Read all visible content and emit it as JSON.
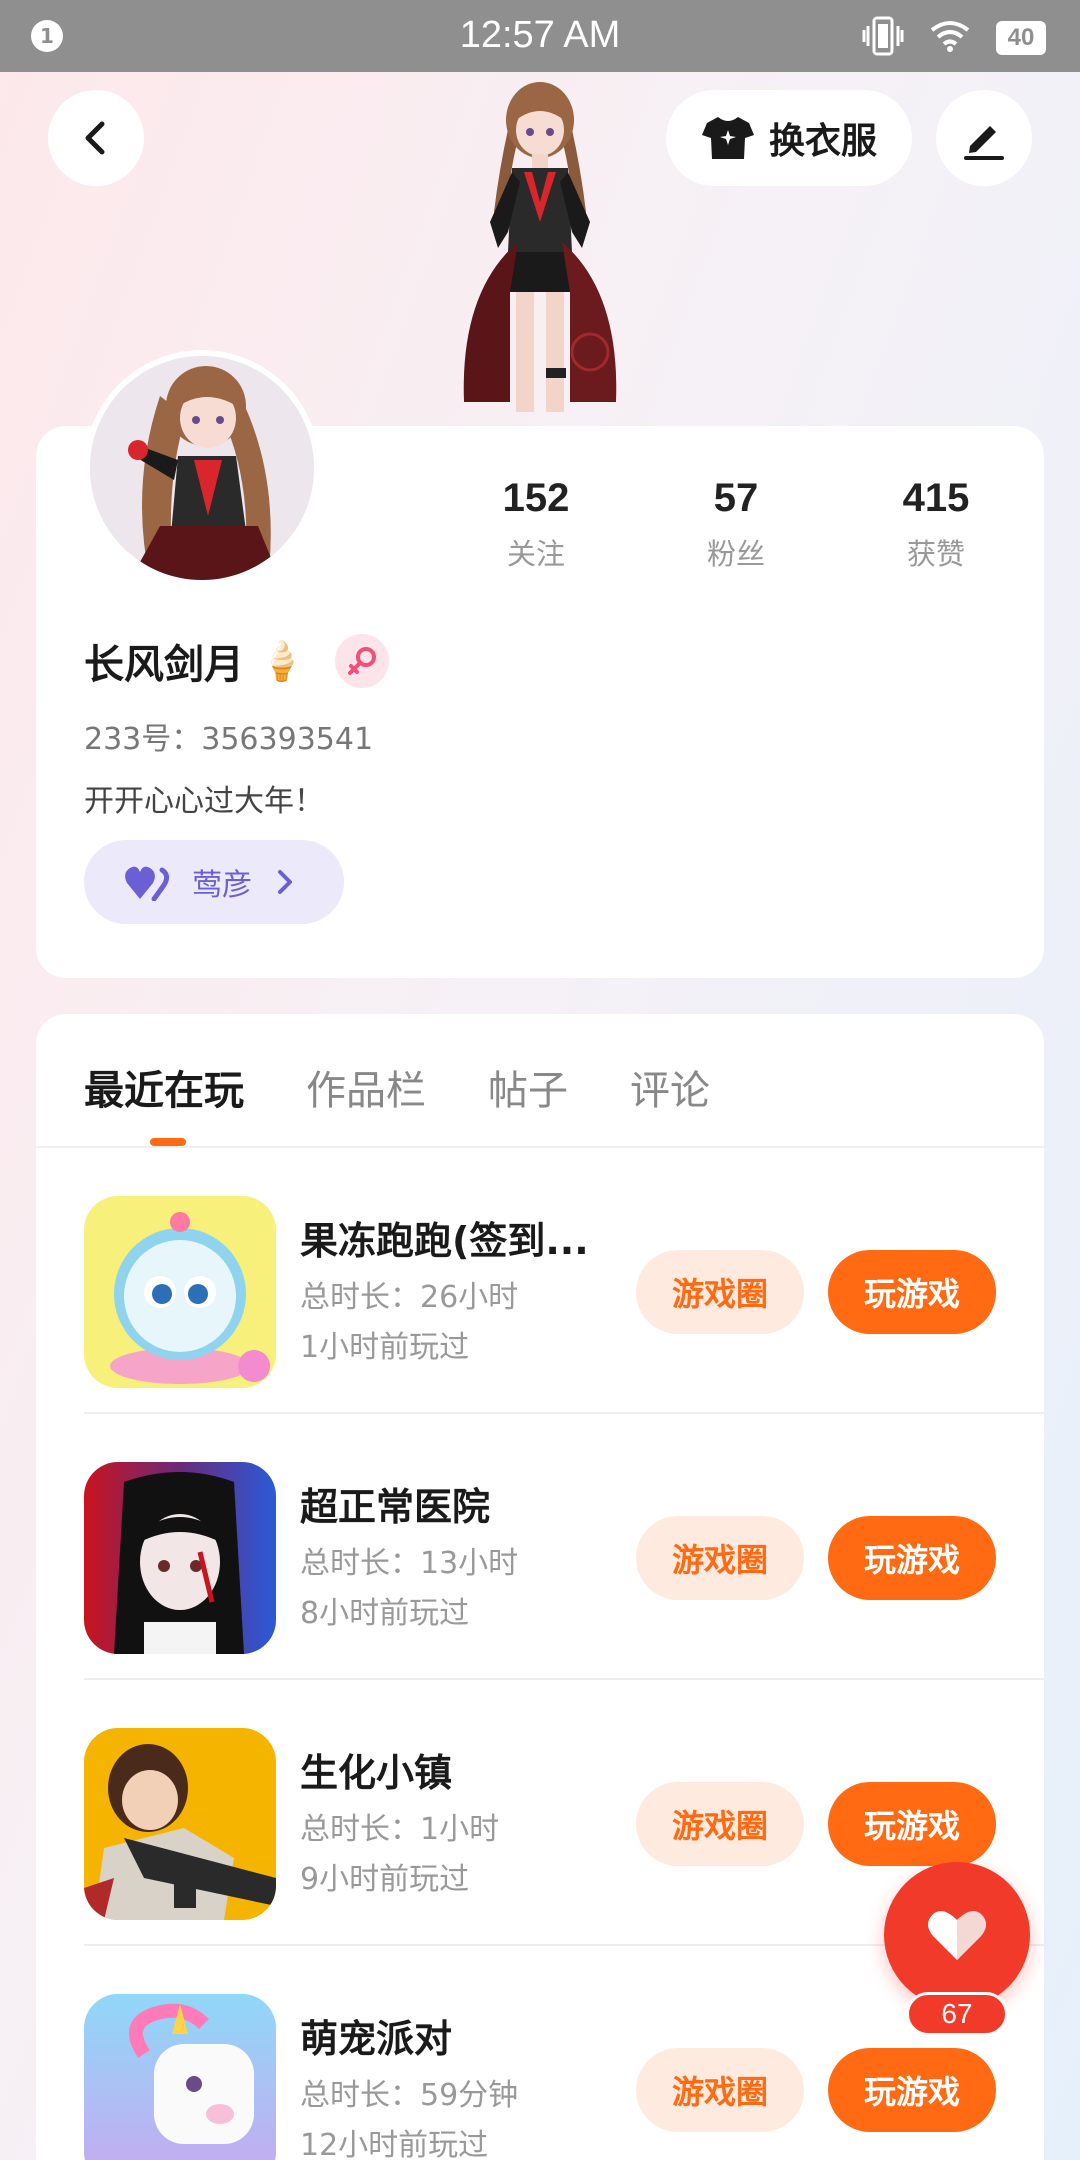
{
  "status_bar": {
    "notification_count": "1",
    "time": "12:57 AM",
    "battery": "40"
  },
  "header": {
    "outfit_label": "换衣服"
  },
  "profile": {
    "stats": [
      {
        "value": "152",
        "label": "关注"
      },
      {
        "value": "57",
        "label": "粉丝"
      },
      {
        "value": "415",
        "label": "获赞"
      }
    ],
    "username": "长风剑月",
    "username_emoji": "🍦",
    "uid": "233号：356393541",
    "bio": "开开心心过大年！",
    "cp_name": "莺彦"
  },
  "tabs": [
    {
      "label": "最近在玩",
      "active": true
    },
    {
      "label": "作品栏",
      "active": false
    },
    {
      "label": "帖子",
      "active": false
    },
    {
      "label": "评论",
      "active": false
    }
  ],
  "games": [
    {
      "name": "果冻跑跑(签到...",
      "total_time": "总时长：26小时",
      "last_played": "1小时前玩过",
      "circle_label": "游戏圈",
      "play_label": "玩游戏"
    },
    {
      "name": "超正常医院",
      "total_time": "总时长：13小时",
      "last_played": "8小时前玩过",
      "circle_label": "游戏圈",
      "play_label": "玩游戏"
    },
    {
      "name": "生化小镇",
      "total_time": "总时长：1小时",
      "last_played": "9小时前玩过",
      "circle_label": "游戏圈",
      "play_label": "玩游戏"
    },
    {
      "name": "萌宠派对",
      "total_time": "总时长：59分钟",
      "last_played": "12小时前玩过",
      "circle_label": "游戏圈",
      "play_label": "玩游戏"
    }
  ],
  "like_fab": {
    "count": "67"
  },
  "colors": {
    "accent": "#ff6a13",
    "like": "#f23a2a",
    "cp_tag": "#6b5fd6"
  }
}
